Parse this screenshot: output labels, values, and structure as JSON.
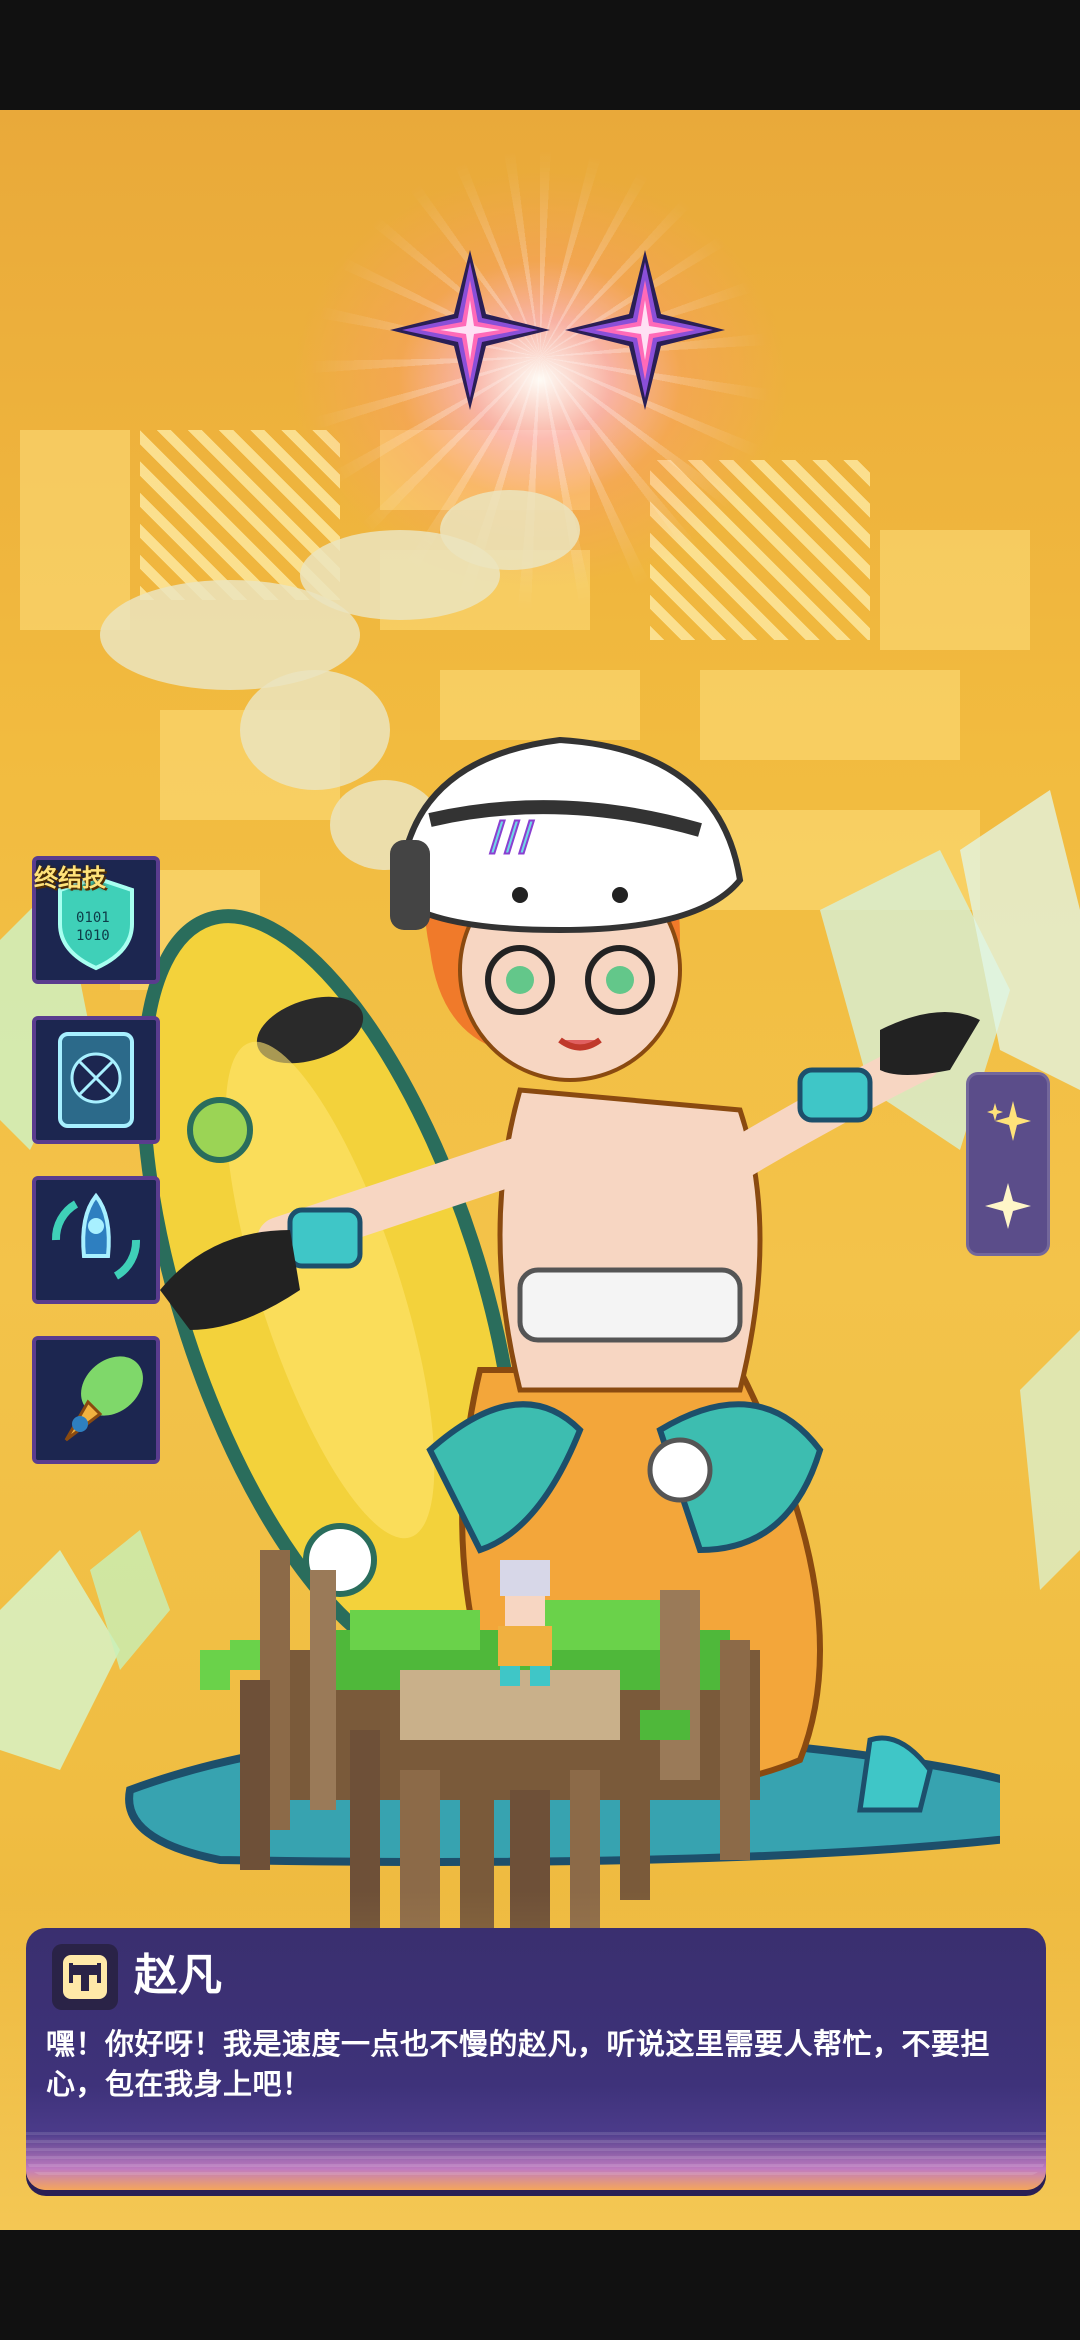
{
  "hud": {
    "ultimate_label": "终结技",
    "skills": [
      {
        "icon": "shield-code-icon",
        "is_ultimate": true
      },
      {
        "icon": "phone-badge-icon",
        "is_ultimate": false
      },
      {
        "icon": "rocket-cycle-icon",
        "is_ultimate": false
      },
      {
        "icon": "comet-pen-icon",
        "is_ultimate": false
      }
    ],
    "side_buttons": [
      {
        "icon": "sparkles-icon"
      },
      {
        "icon": "sparkle-star-icon"
      }
    ],
    "star_rating": 2
  },
  "dialog": {
    "role_icon": "vanguard-class-icon",
    "speaker": "赵凡",
    "text": "嘿！你好呀！我是速度一点也不慢的赵凡，听说这里需要人帮忙，不要担心，包在我身上吧！"
  },
  "colors": {
    "background": "#f2bb3f",
    "dialog_bg": "#3a2f6f",
    "ultimate_label": "#ffe27a",
    "side_panel": "#5b4d8a"
  }
}
